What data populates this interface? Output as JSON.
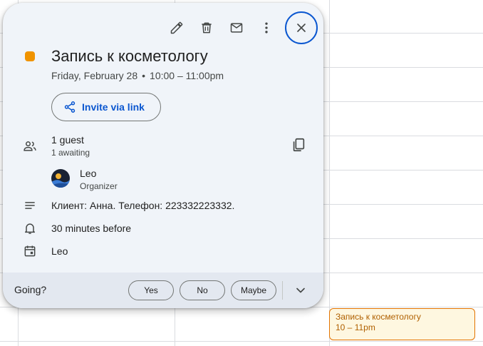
{
  "event": {
    "title": "Запись к косметологу",
    "date": "Friday, February 28",
    "separator": "•",
    "time": "10:00 – 11:00pm",
    "color": "#f09300"
  },
  "toolbar": {
    "edit_icon": "pencil-icon",
    "delete_icon": "trash-icon",
    "email_icon": "mail-icon",
    "more_icon": "more-vert-icon",
    "close_icon": "close-icon"
  },
  "invite": {
    "label": "Invite via link",
    "icon": "share-icon"
  },
  "guests": {
    "count": "1 guest",
    "status": "1 awaiting",
    "list": [
      {
        "name": "Leo",
        "role": "Organizer"
      }
    ]
  },
  "description": "Клиент: Анна. Телефон: 223332223332.",
  "reminder": "30 minutes before",
  "calendar": "Leo",
  "rsvp": {
    "prompt": "Going?",
    "yes": "Yes",
    "no": "No",
    "maybe": "Maybe"
  },
  "calendar_event": {
    "title": "Запись к косметологу",
    "time": "10 – 11pm"
  }
}
